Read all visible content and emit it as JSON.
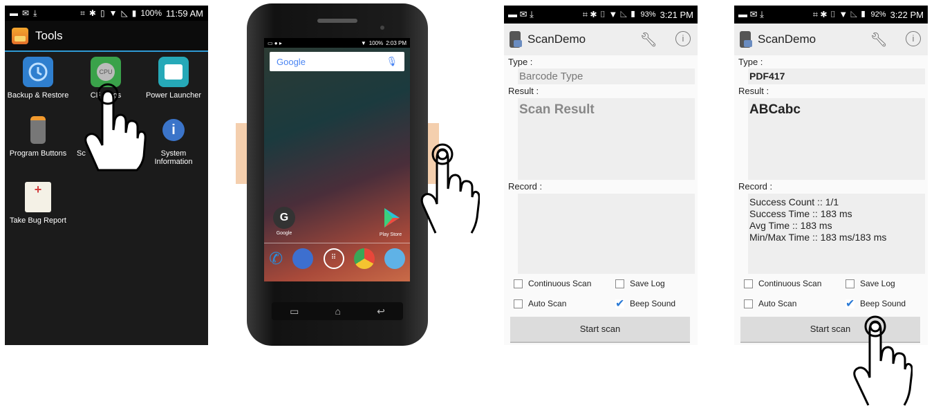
{
  "panel1": {
    "status": {
      "battery": "100%",
      "time": "11:59 AM"
    },
    "title": "Tools",
    "apps": [
      {
        "label": "Backup & Restore",
        "icon": "backup-restore-icon"
      },
      {
        "label": "CPU Settings",
        "icon": "cpu-icon",
        "visible_label": "CF    ngs"
      },
      {
        "label": "Power Launcher",
        "icon": "power-launcher-icon"
      },
      {
        "label": "Program Buttons",
        "icon": "program-buttons-icon"
      },
      {
        "label": "Sc",
        "icon": "scan-icon"
      },
      {
        "label": "System Information",
        "icon": "system-info-icon"
      },
      {
        "label": "Take Bug Report",
        "icon": "bug-report-icon"
      }
    ]
  },
  "phone": {
    "status": {
      "battery": "100%",
      "time": "2:03 PM"
    },
    "search": "Google",
    "apps": [
      {
        "label": "Google"
      },
      {
        "label": "Play Store"
      }
    ]
  },
  "panel3": {
    "status": {
      "battery": "93%",
      "time": "3:21 PM"
    },
    "app_title": "ScanDemo",
    "type_label": "Type :",
    "type_value": "Barcode Type",
    "result_label": "Result :",
    "result_value": "Scan Result",
    "record_label": "Record :",
    "record_lines": [],
    "checkboxes": [
      {
        "label": "Continuous Scan",
        "checked": false
      },
      {
        "label": "Save Log",
        "checked": false
      },
      {
        "label": "Auto Scan",
        "checked": false
      },
      {
        "label": "Beep Sound",
        "checked": true
      }
    ],
    "button": "Start scan"
  },
  "panel4": {
    "status": {
      "battery": "92%",
      "time": "3:22 PM"
    },
    "app_title": "ScanDemo",
    "type_label": "Type :",
    "type_value": "PDF417",
    "result_label": "Result :",
    "result_value": "ABCabc",
    "record_label": "Record :",
    "record_lines": [
      "Success Count :: 1/1",
      "Success Time :: 183 ms",
      "Avg Time :: 183 ms",
      "Min/Max Time :: 183 ms/183 ms"
    ],
    "checkboxes": [
      {
        "label": "Continuous Scan",
        "checked": false
      },
      {
        "label": "Save Log",
        "checked": false
      },
      {
        "label": "Auto Scan",
        "checked": false
      },
      {
        "label": "Beep Sound",
        "checked": true
      }
    ],
    "button": "Start scan"
  },
  "colors": {
    "accent": "#2f9bd6",
    "side_button": "#f2c7a0",
    "checkbox": "#2a7ad6"
  }
}
